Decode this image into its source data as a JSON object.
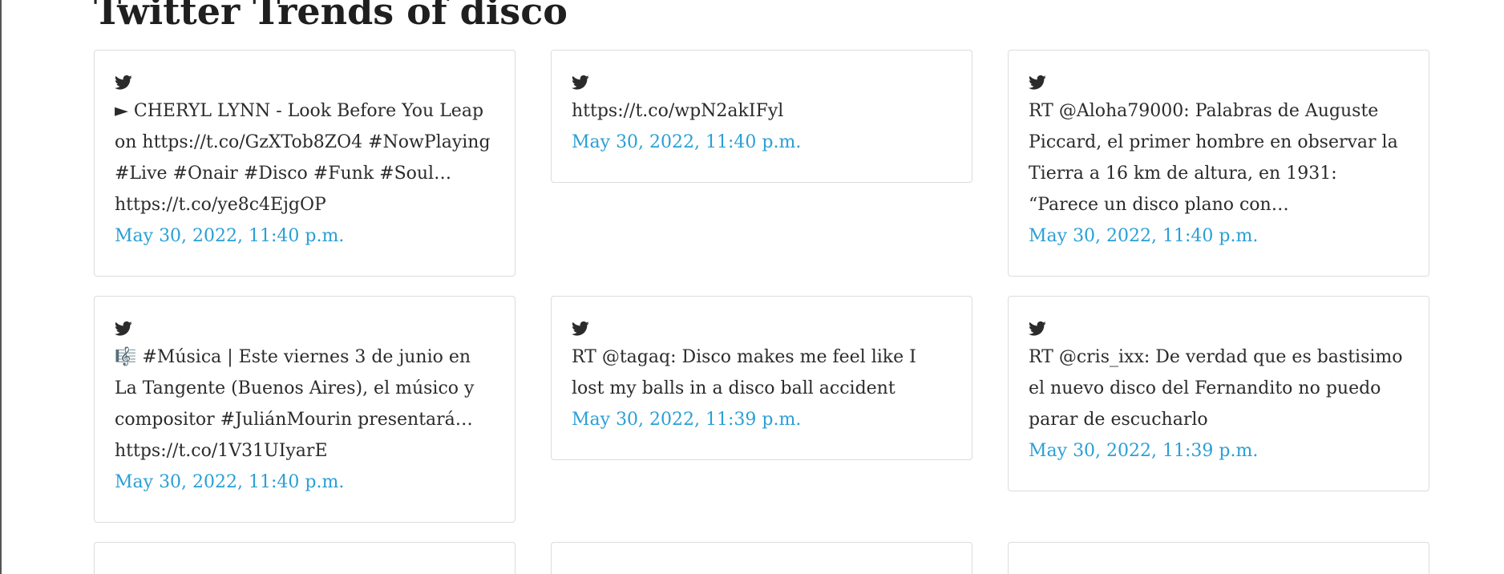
{
  "page": {
    "title": "Twitter Trends of disco"
  },
  "colors": {
    "link": "#2a9fd6",
    "text": "#2b2b2b",
    "card_border": "#dcdcdc"
  },
  "tweets": [
    {
      "icon": "twitter-bird-icon",
      "text": "► CHERYL LYNN - Look Before You Leap on https://t.co/GzXTob8ZO4 #NowPlaying #Live #Onair #Disco #Funk #Soul… https://t.co/ye8c4EjgOP",
      "date": "May 30, 2022, 11:40 p.m."
    },
    {
      "icon": "twitter-bird-icon",
      "text": "https://t.co/wpN2akIFyl",
      "date": "May 30, 2022, 11:40 p.m."
    },
    {
      "icon": "twitter-bird-icon",
      "text": "RT @Aloha79000: Palabras de Auguste Piccard, el primer hombre en observar la Tierra a 16 km de altura, en 1931: “Parece un disco plano con…",
      "date": "May 30, 2022, 11:40 p.m."
    },
    {
      "icon": "twitter-bird-icon",
      "text": "🎼 #Música | Este viernes 3 de junio en La Tangente (Buenos Aires), el músico y compositor #JuliánMourin presentará… https://t.co/1V31UIyarE",
      "date": "May 30, 2022, 11:40 p.m."
    },
    {
      "icon": "twitter-bird-icon",
      "text": "RT @tagaq: Disco makes me feel like I lost my balls in a disco ball accident",
      "date": "May 30, 2022, 11:39 p.m."
    },
    {
      "icon": "twitter-bird-icon",
      "text": "RT @cris_ixx: De verdad que es bastisimo el nuevo disco del Fernandito no puedo parar de escucharlo",
      "date": "May 30, 2022, 11:39 p.m."
    }
  ]
}
